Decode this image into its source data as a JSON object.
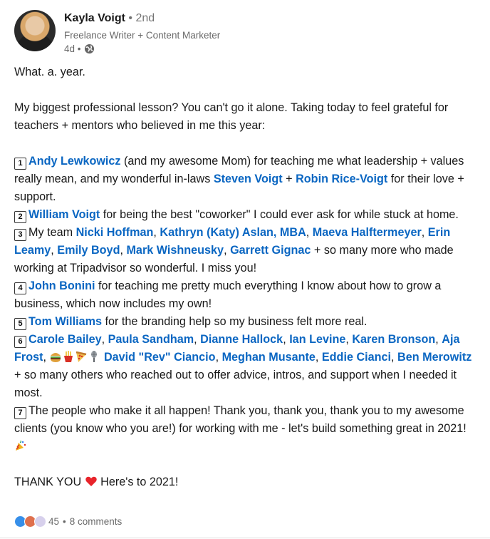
{
  "author": {
    "name": "Kayla Voigt",
    "degree": "• 2nd",
    "headline": "Freelance Writer + Content Marketer",
    "time": "4d •",
    "visibility_icon": "globe-icon"
  },
  "post": {
    "p1": "What. a. year.",
    "p2": "My biggest professional lesson? You can't go it alone. Taking today to feel grateful for teachers + mentors who believed in me this year:",
    "item1": {
      "key": "1",
      "m1": "Andy Lewkowicz",
      "t1": " (and my awesome Mom) for teaching me what leadership + values really mean, and my wonderful in-laws ",
      "m2": "Steven Voigt",
      "t2": " + ",
      "m3": "Robin Rice-Voigt",
      "t3": " for their love + support."
    },
    "item2": {
      "key": "2",
      "m1": "William Voigt",
      "t1": " for being the best \"coworker\" I could ever ask for while stuck at home."
    },
    "item3": {
      "key": "3",
      "t0": "My team ",
      "m1": "Nicki Hoffman",
      "s1": ", ",
      "m2": "Kathryn (Katy) Aslan, MBA",
      "s2": ", ",
      "m3": "Maeva Halftermeyer",
      "s3": ", ",
      "m4": "Erin Leamy",
      "s4": ", ",
      "m5": "Emily Boyd",
      "s5": ", ",
      "m6": "Mark Wishneusky",
      "s6": ", ",
      "m7": "Garrett Gignac",
      "t1": " + so many more who made working at Tripadvisor so wonderful. I miss you!"
    },
    "item4": {
      "key": "4",
      "m1": "John Bonini",
      "t1": " for teaching me pretty much everything I know about how to grow a business, which now includes my own!"
    },
    "item5": {
      "key": "5",
      "m1": "Tom Williams",
      "t1": " for the branding help so my business felt more real."
    },
    "item6": {
      "key": "6",
      "m1": "Carole Bailey",
      "s1": ", ",
      "m2": "Paula Sandham",
      "s2": ", ",
      "m3": "Dianne Hallock",
      "s3": ", ",
      "m4": "Ian Levine",
      "s4": ", ",
      "m5": "Karen Bronson",
      "s5": ", ",
      "m6": "Aja Frost",
      "s6": ", ",
      "emojis": [
        "burger-emoji",
        "fries-emoji",
        "pizza-emoji",
        "microphone-emoji"
      ],
      "m7": "David \"Rev\" Ciancio",
      "s7": ", ",
      "m8": "Meghan Musante",
      "s8": ", ",
      "m9": "Eddie Cianci",
      "s9": ", ",
      "m10": "Ben Merowitz",
      "t1": " + so many others who reached out to offer advice, intros, and support when I needed it most."
    },
    "item7": {
      "key": "7",
      "t1": "The people who make it all happen! Thank you, thank you, thank you to my awesome clients (you know who you are!) for working with me - let's build something great in 2021! "
    },
    "closing_a": "THANK YOU ",
    "closing_b": " Here's to 2021!"
  },
  "social": {
    "reaction_icons": [
      "like-icon",
      "love-icon",
      "curious-icon"
    ],
    "count": "45",
    "sep": "•",
    "comments": "8 comments"
  },
  "colors": {
    "link": "#0a66c2",
    "like": "#378fe9",
    "love": "#df704d"
  }
}
